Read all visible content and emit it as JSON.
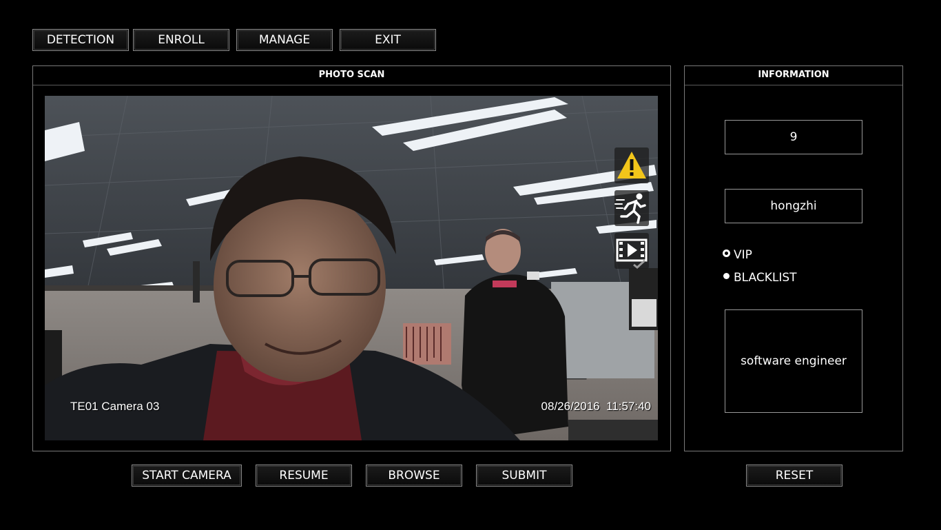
{
  "nav": {
    "detection": "DETECTION",
    "enroll": "ENROLL",
    "manage": "MANAGE",
    "exit": "EXIT"
  },
  "photo_scan": {
    "title": "PHOTO SCAN",
    "camera_label": "TE01 Camera 03",
    "timestamp": "08/26/2016  11:57:40",
    "overlay_icons": [
      "warning-icon",
      "running-person-icon",
      "video-play-icon"
    ]
  },
  "information": {
    "title": "INFORMATION",
    "id": "9",
    "name": "hongzhi",
    "radio_vip": "VIP",
    "radio_blacklist": "BLACKLIST",
    "selected": "VIP",
    "description": "software engineer"
  },
  "actions": {
    "start_camera": "START CAMERA",
    "resume": "RESUME",
    "browse": "BROWSE",
    "submit": "SUBMIT",
    "reset": "RESET"
  }
}
